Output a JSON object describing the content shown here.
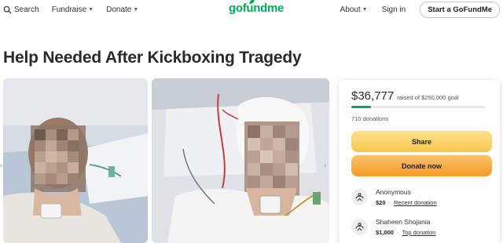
{
  "nav": {
    "search_label": "Search",
    "fundraise_label": "Fundraise",
    "donate_label": "Donate",
    "logo_text": "gofundme",
    "about_label": "About",
    "signin_label": "Sign in",
    "start_label": "Start a GoFundMe"
  },
  "campaign": {
    "title": "Help Needed After Kickboxing Tragedy"
  },
  "donation": {
    "raised_amount": "$36,777",
    "raised_text": "raised of $250,000 goal",
    "progress_fraction": 0.147,
    "donation_count": "710 donations",
    "share_label": "Share",
    "donate_label": "Donate now",
    "donors": [
      {
        "name": "Anonymous",
        "amount": "$20",
        "separator": "·",
        "tag": "Recent donation"
      },
      {
        "name": "Shaheen Shojania",
        "amount": "$1,000",
        "separator": "·",
        "tag": "Top donation"
      }
    ]
  },
  "colors": {
    "brand": "#02a95c",
    "share_button": "#f7c54a",
    "donate_button": "#f49a24"
  }
}
